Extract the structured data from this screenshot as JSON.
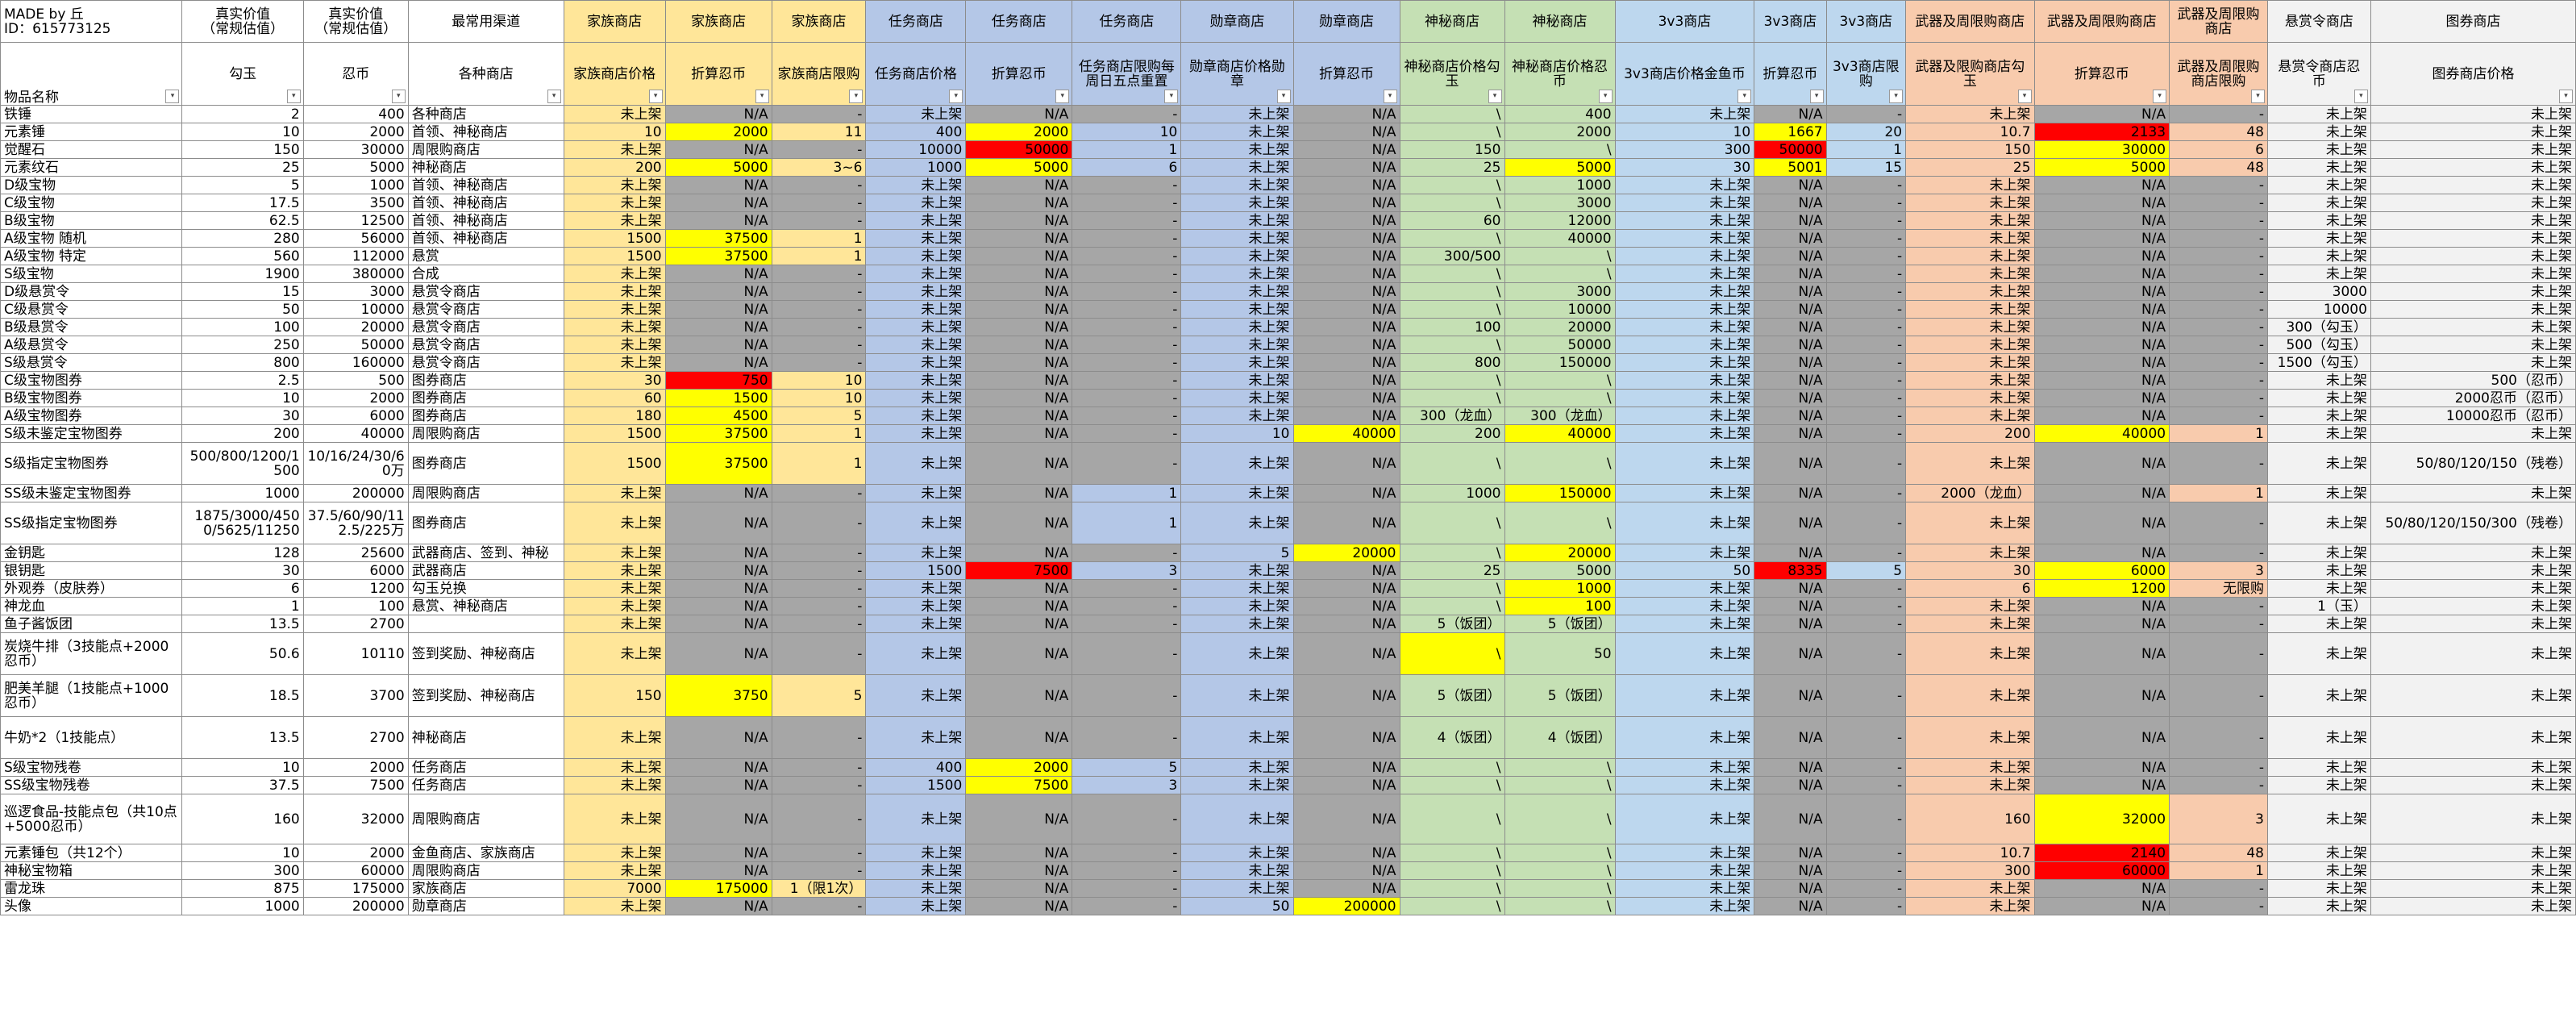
{
  "title": {
    "line1": "MADE by 丘",
    "line2": "ID：615773125"
  },
  "headers_top": [
    "MADE by 丘\nID：615773125",
    "真实价值\n（常规估值）",
    "真实价值\n（常规估值）",
    "最常用渠道",
    "家族商店",
    "家族商店",
    "家族商店",
    "任务商店",
    "任务商店",
    "任务商店",
    "勋章商店",
    "勋章商店",
    "神秘商店",
    "神秘商店",
    "3v3商店",
    "3v3商店",
    "3v3商店",
    "武器及周限购商店",
    "武器及周限购商店",
    "武器及周限购商店",
    "悬赏令商店",
    "图券商店"
  ],
  "headers_sub": [
    "物品名称",
    "勾玉",
    "忍币",
    "各种商店",
    "家族商店价格",
    "折算忍币",
    "家族商店限购",
    "任务商店价格",
    "折算忍币",
    "任务商店限购每周日五点重置",
    "勋章商店价格勋章",
    "折算忍币",
    "神秘商店价格勾玉",
    "神秘商店价格忍币",
    "3v3商店价格金鱼币",
    "折算忍币",
    "3v3商店限购",
    "武器及限购商店勾玉",
    "折算忍币",
    "武器及周限购商店限购",
    "悬赏令商店忍币",
    "图券商店价格"
  ],
  "rows": [
    [
      "铁锤",
      "2",
      "400",
      "各种商店",
      "未上架",
      "N/A",
      "-",
      "未上架",
      "N/A",
      "-",
      "未上架",
      "N/A",
      "\\",
      "400",
      "未上架",
      "N/A",
      "-",
      "未上架",
      "N/A",
      "-",
      "未上架",
      "未上架"
    ],
    [
      "元素锤",
      "10",
      "2000",
      "首领、神秘商店",
      "10",
      "2000",
      "11",
      "400",
      "2000",
      "10",
      "未上架",
      "N/A",
      "\\",
      "2000",
      "10",
      "1667",
      "20",
      "10.7",
      "2133",
      "48",
      "未上架",
      "未上架"
    ],
    [
      "觉醒石",
      "150",
      "30000",
      "周限购商店",
      "未上架",
      "N/A",
      "-",
      "10000",
      "50000",
      "1",
      "未上架",
      "N/A",
      "150",
      "\\",
      "300",
      "50000",
      "1",
      "150",
      "30000",
      "6",
      "未上架",
      "未上架"
    ],
    [
      "元素纹石",
      "25",
      "5000",
      "神秘商店",
      "200",
      "5000",
      "3~6",
      "1000",
      "5000",
      "6",
      "未上架",
      "N/A",
      "25",
      "5000",
      "30",
      "5001",
      "15",
      "25",
      "5000",
      "48",
      "未上架",
      "未上架"
    ],
    [
      "D级宝物",
      "5",
      "1000",
      "首领、神秘商店",
      "未上架",
      "N/A",
      "-",
      "未上架",
      "N/A",
      "-",
      "未上架",
      "N/A",
      "\\",
      "1000",
      "未上架",
      "N/A",
      "-",
      "未上架",
      "N/A",
      "-",
      "未上架",
      "未上架"
    ],
    [
      "C级宝物",
      "17.5",
      "3500",
      "首领、神秘商店",
      "未上架",
      "N/A",
      "-",
      "未上架",
      "N/A",
      "-",
      "未上架",
      "N/A",
      "\\",
      "3000",
      "未上架",
      "N/A",
      "-",
      "未上架",
      "N/A",
      "-",
      "未上架",
      "未上架"
    ],
    [
      "B级宝物",
      "62.5",
      "12500",
      "首领、神秘商店",
      "未上架",
      "N/A",
      "-",
      "未上架",
      "N/A",
      "-",
      "未上架",
      "N/A",
      "60",
      "12000",
      "未上架",
      "N/A",
      "-",
      "未上架",
      "N/A",
      "-",
      "未上架",
      "未上架"
    ],
    [
      "A级宝物 随机",
      "280",
      "56000",
      "首领、神秘商店",
      "1500",
      "37500",
      "1",
      "未上架",
      "N/A",
      "-",
      "未上架",
      "N/A",
      "\\",
      "40000",
      "未上架",
      "N/A",
      "-",
      "未上架",
      "N/A",
      "-",
      "未上架",
      "未上架"
    ],
    [
      "A级宝物 特定",
      "560",
      "112000",
      "悬赏",
      "1500",
      "37500",
      "1",
      "未上架",
      "N/A",
      "-",
      "未上架",
      "N/A",
      "300/500",
      "\\",
      "未上架",
      "N/A",
      "-",
      "未上架",
      "N/A",
      "-",
      "未上架",
      "未上架"
    ],
    [
      "S级宝物",
      "1900",
      "380000",
      "合成",
      "未上架",
      "N/A",
      "-",
      "未上架",
      "N/A",
      "-",
      "未上架",
      "N/A",
      "\\",
      "\\",
      "未上架",
      "N/A",
      "-",
      "未上架",
      "N/A",
      "-",
      "未上架",
      "未上架"
    ],
    [
      "D级悬赏令",
      "15",
      "3000",
      "悬赏令商店",
      "未上架",
      "N/A",
      "-",
      "未上架",
      "N/A",
      "-",
      "未上架",
      "N/A",
      "\\",
      "3000",
      "未上架",
      "N/A",
      "-",
      "未上架",
      "N/A",
      "-",
      "3000",
      "未上架"
    ],
    [
      "C级悬赏令",
      "50",
      "10000",
      "悬赏令商店",
      "未上架",
      "N/A",
      "-",
      "未上架",
      "N/A",
      "-",
      "未上架",
      "N/A",
      "\\",
      "10000",
      "未上架",
      "N/A",
      "-",
      "未上架",
      "N/A",
      "-",
      "10000",
      "未上架"
    ],
    [
      "B级悬赏令",
      "100",
      "20000",
      "悬赏令商店",
      "未上架",
      "N/A",
      "-",
      "未上架",
      "N/A",
      "-",
      "未上架",
      "N/A",
      "100",
      "20000",
      "未上架",
      "N/A",
      "-",
      "未上架",
      "N/A",
      "-",
      "300（勾玉）",
      "未上架"
    ],
    [
      "A级悬赏令",
      "250",
      "50000",
      "悬赏令商店",
      "未上架",
      "N/A",
      "-",
      "未上架",
      "N/A",
      "-",
      "未上架",
      "N/A",
      "\\",
      "50000",
      "未上架",
      "N/A",
      "-",
      "未上架",
      "N/A",
      "-",
      "500（勾玉）",
      "未上架"
    ],
    [
      "S级悬赏令",
      "800",
      "160000",
      "悬赏令商店",
      "未上架",
      "N/A",
      "-",
      "未上架",
      "N/A",
      "-",
      "未上架",
      "N/A",
      "800",
      "150000",
      "未上架",
      "N/A",
      "-",
      "未上架",
      "N/A",
      "-",
      "1500（勾玉）",
      "未上架"
    ],
    [
      "C级宝物图券",
      "2.5",
      "500",
      "图券商店",
      "30",
      "750",
      "10",
      "未上架",
      "N/A",
      "-",
      "未上架",
      "N/A",
      "\\",
      "\\",
      "未上架",
      "N/A",
      "-",
      "未上架",
      "N/A",
      "-",
      "未上架",
      "500（忍币）"
    ],
    [
      "B级宝物图券",
      "10",
      "2000",
      "图券商店",
      "60",
      "1500",
      "10",
      "未上架",
      "N/A",
      "-",
      "未上架",
      "N/A",
      "\\",
      "\\",
      "未上架",
      "N/A",
      "-",
      "未上架",
      "N/A",
      "-",
      "未上架",
      "2000忍币（忍币）"
    ],
    [
      "A级宝物图券",
      "30",
      "6000",
      "图券商店",
      "180",
      "4500",
      "5",
      "未上架",
      "N/A",
      "-",
      "未上架",
      "N/A",
      "300（龙血）",
      "300（龙血）",
      "未上架",
      "N/A",
      "-",
      "未上架",
      "N/A",
      "-",
      "未上架",
      "10000忍币（忍币）"
    ],
    [
      "S级未鉴定宝物图券",
      "200",
      "40000",
      "周限购商店",
      "1500",
      "37500",
      "1",
      "未上架",
      "N/A",
      "-",
      "10",
      "40000",
      "200",
      "40000",
      "未上架",
      "N/A",
      "-",
      "200",
      "40000",
      "1",
      "未上架",
      "未上架"
    ],
    [
      "S级指定宝物图券",
      "500/800/1200/1500",
      "10/16/24/30/60万",
      "图券商店",
      "1500",
      "37500",
      "1",
      "未上架",
      "N/A",
      "-",
      "未上架",
      "N/A",
      "\\",
      "\\",
      "未上架",
      "N/A",
      "-",
      "未上架",
      "N/A",
      "-",
      "未上架",
      "50/80/120/150（残卷）"
    ],
    [
      "SS级未鉴定宝物图券",
      "1000",
      "200000",
      "周限购商店",
      "未上架",
      "N/A",
      "-",
      "未上架",
      "N/A",
      "1",
      "未上架",
      "N/A",
      "1000",
      "150000",
      "未上架",
      "N/A",
      "-",
      "2000（龙血）",
      "N/A",
      "1",
      "未上架",
      "未上架"
    ],
    [
      "SS级指定宝物图券",
      "1875/3000/4500/5625/11250",
      "37.5/60/90/112.5/225万",
      "图券商店",
      "未上架",
      "N/A",
      "-",
      "未上架",
      "N/A",
      "1",
      "未上架",
      "N/A",
      "\\",
      "\\",
      "未上架",
      "N/A",
      "-",
      "未上架",
      "N/A",
      "-",
      "未上架",
      "50/80/120/150/300（残卷）"
    ],
    [
      "金钥匙",
      "128",
      "25600",
      "武器商店、签到、神秘",
      "未上架",
      "N/A",
      "-",
      "未上架",
      "N/A",
      "-",
      "5",
      "20000",
      "\\",
      "20000",
      "未上架",
      "N/A",
      "-",
      "未上架",
      "N/A",
      "-",
      "未上架",
      "未上架"
    ],
    [
      "银钥匙",
      "30",
      "6000",
      "武器商店",
      "未上架",
      "N/A",
      "-",
      "1500",
      "7500",
      "3",
      "未上架",
      "N/A",
      "25",
      "5000",
      "50",
      "8335",
      "5",
      "30",
      "6000",
      "3",
      "未上架",
      "未上架"
    ],
    [
      "外观券（皮肤券）",
      "6",
      "1200",
      "勾玉兑换",
      "未上架",
      "N/A",
      "-",
      "未上架",
      "N/A",
      "-",
      "未上架",
      "N/A",
      "\\",
      "1000",
      "未上架",
      "N/A",
      "-",
      "6",
      "1200",
      "无限购",
      "未上架",
      "未上架"
    ],
    [
      "神龙血",
      "1",
      "100",
      "悬赏、神秘商店",
      "未上架",
      "N/A",
      "-",
      "未上架",
      "N/A",
      "-",
      "未上架",
      "N/A",
      "\\",
      "100",
      "未上架",
      "N/A",
      "-",
      "未上架",
      "N/A",
      "-",
      "1（玉）",
      "未上架"
    ],
    [
      "鱼子酱饭团",
      "13.5",
      "2700",
      "",
      "未上架",
      "N/A",
      "-",
      "未上架",
      "N/A",
      "-",
      "未上架",
      "N/A",
      "5（饭团）",
      "5（饭团）",
      "未上架",
      "N/A",
      "-",
      "未上架",
      "N/A",
      "-",
      "未上架",
      "未上架"
    ],
    [
      "炭烧牛排（3技能点+2000忍币）",
      "50.6",
      "10110",
      "签到奖励、神秘商店",
      "未上架",
      "N/A",
      "-",
      "未上架",
      "N/A",
      "-",
      "未上架",
      "N/A",
      "\\",
      "50",
      "未上架",
      "N/A",
      "-",
      "未上架",
      "N/A",
      "-",
      "未上架",
      "未上架"
    ],
    [
      "肥美羊腿（1技能点+1000忍币）",
      "18.5",
      "3700",
      "签到奖励、神秘商店",
      "150",
      "3750",
      "5",
      "未上架",
      "N/A",
      "-",
      "未上架",
      "N/A",
      "5（饭团）",
      "5（饭团）",
      "未上架",
      "N/A",
      "-",
      "未上架",
      "N/A",
      "-",
      "未上架",
      "未上架"
    ],
    [
      "牛奶*2（1技能点）",
      "13.5",
      "2700",
      "神秘商店",
      "未上架",
      "N/A",
      "-",
      "未上架",
      "N/A",
      "-",
      "未上架",
      "N/A",
      "4（饭团）",
      "4（饭团）",
      "未上架",
      "N/A",
      "-",
      "未上架",
      "N/A",
      "-",
      "未上架",
      "未上架"
    ],
    [
      "S级宝物残卷",
      "10",
      "2000",
      "任务商店",
      "未上架",
      "N/A",
      "-",
      "400",
      "2000",
      "5",
      "未上架",
      "N/A",
      "\\",
      "\\",
      "未上架",
      "N/A",
      "-",
      "未上架",
      "N/A",
      "-",
      "未上架",
      "未上架"
    ],
    [
      "SS级宝物残卷",
      "37.5",
      "7500",
      "任务商店",
      "未上架",
      "N/A",
      "-",
      "1500",
      "7500",
      "3",
      "未上架",
      "N/A",
      "\\",
      "\\",
      "未上架",
      "N/A",
      "-",
      "未上架",
      "N/A",
      "-",
      "未上架",
      "未上架"
    ],
    [
      "巡逻食品-技能点包（共10点+5000忍币）",
      "160",
      "32000",
      "周限购商店",
      "未上架",
      "N/A",
      "-",
      "未上架",
      "N/A",
      "-",
      "未上架",
      "N/A",
      "\\",
      "\\",
      "未上架",
      "N/A",
      "-",
      "160",
      "32000",
      "3",
      "未上架",
      "未上架"
    ],
    [
      "元素锤包（共12个）",
      "10",
      "2000",
      "金鱼商店、家族商店",
      "未上架",
      "N/A",
      "-",
      "未上架",
      "N/A",
      "-",
      "未上架",
      "N/A",
      "\\",
      "\\",
      "未上架",
      "N/A",
      "-",
      "10.7",
      "2140",
      "48",
      "未上架",
      "未上架"
    ],
    [
      "神秘宝物箱",
      "300",
      "60000",
      "周限购商店",
      "未上架",
      "N/A",
      "-",
      "未上架",
      "N/A",
      "-",
      "未上架",
      "N/A",
      "\\",
      "\\",
      "未上架",
      "N/A",
      "-",
      "300",
      "60000",
      "1",
      "未上架",
      "未上架"
    ],
    [
      "雷龙珠",
      "875",
      "175000",
      "家族商店",
      "7000",
      "175000",
      "1（限1次）",
      "未上架",
      "N/A",
      "-",
      "未上架",
      "N/A",
      "\\",
      "\\",
      "未上架",
      "N/A",
      "-",
      "未上架",
      "N/A",
      "-",
      "未上架",
      "未上架"
    ],
    [
      "头像",
      "1000",
      "200000",
      "勋章商店",
      "未上架",
      "N/A",
      "-",
      "未上架",
      "N/A",
      "-",
      "50",
      "200000",
      "\\",
      "\\",
      "未上架",
      "N/A",
      "-",
      "未上架",
      "N/A",
      "-",
      "未上架",
      "未上架"
    ]
  ],
  "colors": {
    "family": "#ffe699",
    "task": "#b4c7e7",
    "mystery": "#c5e0b4",
    "v3": "#bdd7ee",
    "weapon": "#f8cbad",
    "bounty": "#f2f2f2",
    "gray": "#a6a6a6",
    "yellow": "#ffff00",
    "red": "#ff0000"
  }
}
